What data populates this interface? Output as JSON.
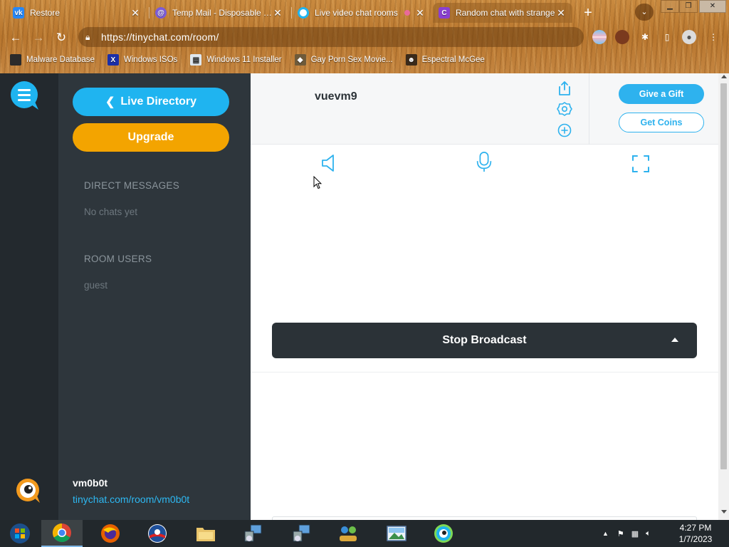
{
  "browser": {
    "tabs": [
      {
        "title": "Restore",
        "favicon": "vk-icon",
        "color": "#2787f5",
        "active": false
      },
      {
        "title": "Temp Mail - Disposable Te",
        "favicon": "at-icon",
        "color": "#7b5cd6",
        "active": false
      },
      {
        "title": "Live video chat rooms",
        "favicon": "tinychat-icon",
        "color": "#1fb4f0",
        "active": false
      },
      {
        "title": "Random chat with strange",
        "favicon": "c-icon",
        "color": "#8a3fd1",
        "active": true
      }
    ],
    "url": "https://tinychat.com/room/",
    "bookmarks": [
      {
        "label": "Malware Database"
      },
      {
        "label": "Windows ISOs"
      },
      {
        "label": "Windows 11 Installer"
      },
      {
        "label": "Gay Porn Sex Movie..."
      },
      {
        "label": "Espectral McGee"
      }
    ]
  },
  "sidebar": {
    "live_directory": "Live Directory",
    "upgrade": "Upgrade",
    "direct_messages_title": "DIRECT MESSAGES",
    "direct_messages_empty": "No chats yet",
    "room_users_title": "ROOM USERS",
    "room_users": [
      "guest"
    ],
    "profile_name": "vm0b0t",
    "profile_link": "tinychat.com/room/vm0b0t"
  },
  "room": {
    "name": "vuevm9",
    "give_gift": "Give a Gift",
    "get_coins": "Get Coins",
    "broadcast_button": "Stop Broadcast"
  },
  "taskbar": {
    "time": "4:27 PM",
    "date": "1/7/2023"
  },
  "colors": {
    "accent": "#1fb4f0",
    "upgrade": "#f3a400",
    "rail": "#23292e",
    "sidebar": "#2e363c",
    "dark_button": "#2b3237"
  }
}
